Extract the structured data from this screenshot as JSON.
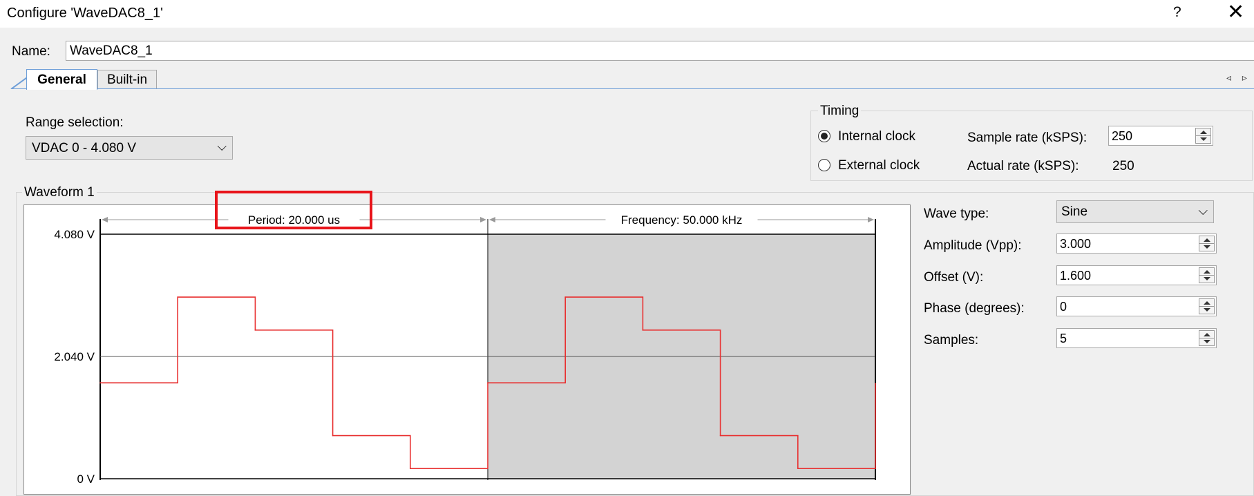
{
  "window": {
    "title": "Configure 'WaveDAC8_1'",
    "help_label": "?",
    "close_label": "✕"
  },
  "name_field": {
    "label": "Name:",
    "value": "WaveDAC8_1"
  },
  "tabs": [
    {
      "label": "General",
      "active": true
    },
    {
      "label": "Built-in",
      "active": false
    }
  ],
  "tab_scroll": "◃ ▹",
  "range": {
    "label": "Range selection:",
    "value": "VDAC 0 - 4.080 V"
  },
  "timing": {
    "title": "Timing",
    "internal_clock_label": "Internal clock",
    "internal_clock_selected": true,
    "external_clock_label": "External clock",
    "external_clock_selected": false,
    "sample_rate_label": "Sample rate (kSPS):",
    "sample_rate_value": "250",
    "actual_rate_label": "Actual rate (kSPS):",
    "actual_rate_value": "250"
  },
  "waveform": {
    "title": "Waveform 1",
    "wave_type_label": "Wave type:",
    "wave_type_value": "Sine",
    "amplitude_label": "Amplitude (Vpp):",
    "amplitude_value": "3.000",
    "offset_label": "Offset (V):",
    "offset_value": "1.600",
    "phase_label": "Phase (degrees):",
    "phase_value": "0",
    "samples_label": "Samples:",
    "samples_value": "5"
  },
  "chart": {
    "period_label": "Period: 20.000 us",
    "frequency_label": "Frequency: 50.000 kHz",
    "y_ticks": [
      "4.080 V",
      "2.040 V",
      "0 V"
    ],
    "highlight_color": "#e8141a",
    "wave_color": "#e83030",
    "second_period_color": "#d3d3d3"
  },
  "chart_data": {
    "type": "line",
    "step": true,
    "x_unit": "us",
    "xlim": [
      0,
      40
    ],
    "ylim": [
      0,
      4.08
    ],
    "y_ticks": [
      0,
      2.04,
      4.08
    ],
    "series": [
      {
        "x": [
          0,
          4,
          8,
          12,
          16,
          20,
          24,
          28,
          32,
          36,
          40
        ],
        "y": [
          1.6,
          3.03,
          2.48,
          0.72,
          0.17,
          1.6,
          3.03,
          2.48,
          0.72,
          0.17,
          1.6
        ]
      }
    ]
  }
}
